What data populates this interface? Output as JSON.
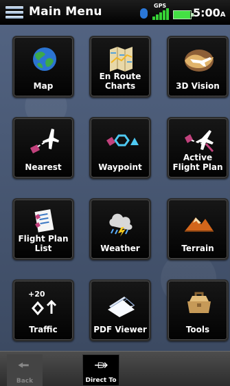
{
  "status": {
    "title": "Main Menu",
    "gps_label": "GPS",
    "time": "5:00",
    "time_suffix": "A",
    "battery_level": 0.95,
    "gps_signal_bars": 5
  },
  "tiles": [
    {
      "id": "map",
      "label": "Map",
      "icon": "globe-icon"
    },
    {
      "id": "en-route-charts",
      "label": "En Route\nCharts",
      "icon": "folded-map-icon"
    },
    {
      "id": "3d-vision",
      "label": "3D Vision",
      "icon": "aircraft-terrain-icon"
    },
    {
      "id": "nearest",
      "label": "Nearest",
      "icon": "nearest-airplane-icon"
    },
    {
      "id": "waypoint",
      "label": "Waypoint",
      "icon": "waypoint-symbols-icon"
    },
    {
      "id": "active-flight-plan",
      "label": "Active\nFlight Plan",
      "icon": "flight-plan-route-icon"
    },
    {
      "id": "flight-plan-list",
      "label": "Flight Plan\nList",
      "icon": "flight-plan-list-icon"
    },
    {
      "id": "weather",
      "label": "Weather",
      "icon": "storm-cloud-icon"
    },
    {
      "id": "terrain",
      "label": "Terrain",
      "icon": "mountain-icon"
    },
    {
      "id": "traffic",
      "label": "Traffic",
      "icon": "traffic-diamond-icon",
      "icon_text": "+20"
    },
    {
      "id": "pdf-viewer",
      "label": "PDF Viewer",
      "icon": "document-stack-icon"
    },
    {
      "id": "tools",
      "label": "Tools",
      "icon": "toolbox-icon"
    }
  ],
  "bottom": {
    "back_label": "Back",
    "direct_to_label": "Direct To"
  },
  "colors": {
    "background": "#3f4f68",
    "tile": "#050505",
    "bluetooth": "#2a77d8",
    "gps": "#36d236",
    "battery": "#44e044",
    "waypoint_magenta": "#c2427d",
    "waypoint_cyan": "#4ec9f2"
  }
}
